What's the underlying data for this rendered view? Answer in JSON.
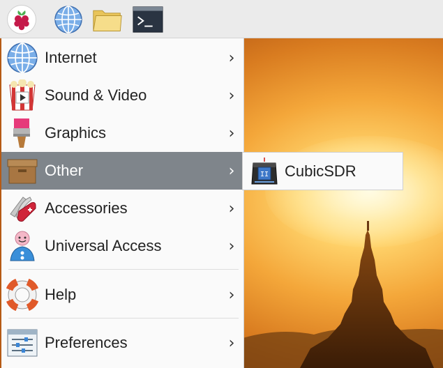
{
  "taskbar": {
    "buttons": [
      {
        "name": "raspberry-menu-button",
        "icon": "raspberry-icon"
      },
      {
        "name": "web-browser-button",
        "icon": "globe-icon"
      },
      {
        "name": "file-manager-button",
        "icon": "folder-icon"
      },
      {
        "name": "terminal-button",
        "icon": "terminal-icon"
      }
    ]
  },
  "menu": {
    "items": [
      {
        "label": "Internet",
        "icon": "globe-icon",
        "chevron": "›"
      },
      {
        "label": "Sound & Video",
        "icon": "popcorn-icon",
        "chevron": "›"
      },
      {
        "label": "Graphics",
        "icon": "paintbrush-icon",
        "chevron": "›"
      },
      {
        "label": "Other",
        "icon": "box-icon",
        "chevron": "›",
        "active": true
      },
      {
        "label": "Accessories",
        "icon": "swiss-knife-icon",
        "chevron": "›"
      },
      {
        "label": "Universal Access",
        "icon": "accessibility-person-icon",
        "chevron": "›"
      },
      {
        "label": "Help",
        "icon": "lifebuoy-icon",
        "chevron": "›"
      },
      {
        "label": "Preferences",
        "icon": "settings-sliders-icon",
        "chevron": "›"
      }
    ],
    "active_color": "#7f858b"
  },
  "submenu": {
    "items": [
      {
        "label": "CubicSDR",
        "icon": "cubicsdr-icon"
      }
    ]
  }
}
